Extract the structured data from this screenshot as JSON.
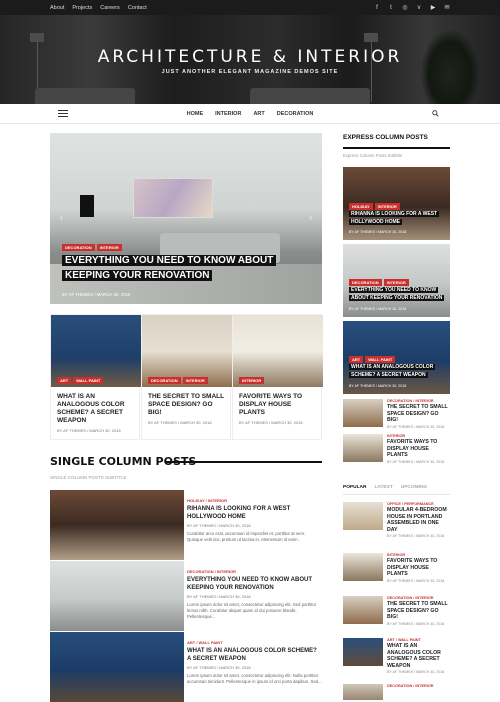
{
  "topbar": {
    "links": [
      "About",
      "Projects",
      "Careers",
      "Contact"
    ],
    "social_icons": [
      "facebook-icon",
      "twitter-icon",
      "instagram-icon",
      "vk-icon",
      "youtube-icon",
      "envelope-icon"
    ]
  },
  "header": {
    "title": "ARCHITECTURE & INTERIOR",
    "tagline": "JUST ANOTHER ELEGANT MAGAZINE DEMOS SITE"
  },
  "nav": {
    "items": [
      "HOME",
      "INTERIOR",
      "ART",
      "DECORATION"
    ],
    "search_icon": "search-icon",
    "menu_icon": "hamburger-icon"
  },
  "featured": {
    "tags": [
      "DECORATION",
      "INTERIOR"
    ],
    "title": "EVERYTHING YOU NEED TO KNOW ABOUT KEEPING YOUR RENOVATION",
    "author": "BY AF THEMES",
    "date": "MARCH 30, 2018"
  },
  "cards": [
    {
      "tags": [
        "ART",
        "WALL PAINT"
      ],
      "title": "WHAT IS AN ANALOGOUS COLOR SCHEME? A SECRET WEAPON",
      "meta": "BY AF THEMES / MARCH 30, 2018"
    },
    {
      "tags": [
        "DECORATION",
        "INTERIOR"
      ],
      "title": "THE SECRET TO SMALL SPACE DESIGN? GO BIG!",
      "meta": "BY AF THEMES / MARCH 30, 2018"
    },
    {
      "tags": [
        "INTERIOR"
      ],
      "title": "FAVORITE WAYS TO DISPLAY HOUSE PLANTS",
      "meta": "BY AF THEMES / MARCH 30, 2018"
    }
  ],
  "single_column": {
    "title": "SINGLE COLUMN POSTS",
    "subtitle": "SINGLE COLUMN POSTS SUBTITLE",
    "posts": [
      {
        "cat": "HOLIDAY / INTERIOR",
        "title": "RIHANNA IS LOOKING FOR A WEST HOLLYWOOD HOME",
        "meta": "BY AF THEMES / MARCH 30, 2018",
        "excerpt": "Curabitur arcu erat, accumsan id imperdiet et, porttitor at sem. Quisque velit nisi, pretium ut lacinia in, elementum id enim."
      },
      {
        "cat": "DECORATION / INTERIOR",
        "title": "EVERYTHING YOU NEED TO KNOW ABOUT KEEPING YOUR RENOVATION",
        "meta": "BY AF THEMES / MARCH 30, 2018",
        "excerpt": "Lorem ipsum dolor sit amet, consectetur adipiscing elit. Sed porttitor lectus nibh. Curabitur aliquet quam id dui posuere blandit. Pellentesque..."
      },
      {
        "cat": "ART / WALL PAINT",
        "title": "WHAT IS AN ANALOGOUS COLOR SCHEME? A SECRET WEAPON",
        "meta": "BY AF THEMES / MARCH 30, 2018",
        "excerpt": "Lorem ipsum dolor sit amet, consectetur adipiscing elit. Nulla porttitor accumsan tincidunt. Pellentesque in ipsum id orci porta dapibus. Sed..."
      }
    ]
  },
  "express": {
    "title": "EXPRESS COLUMN POSTS",
    "subtitle": "Express Column Posts Subtitle",
    "features": [
      {
        "tags": [
          "HOLIDAY",
          "INTERIOR"
        ],
        "title": "RIHANNA IS LOOKING FOR A WEST HOLLYWOOD HOME",
        "meta": "BY AF THEMES / MARCH 30, 2018"
      },
      {
        "tags": [
          "DECORATION",
          "INTERIOR"
        ],
        "title": "EVERYTHING YOU NEED TO KNOW ABOUT KEEPING YOUR RENOVATION",
        "meta": "BY AF THEMES / MARCH 30, 2018"
      },
      {
        "tags": [
          "ART",
          "WALL PAINT"
        ],
        "title": "WHAT IS AN ANALOGOUS COLOR SCHEME? A SECRET WEAPON",
        "meta": "BY AF THEMES / MARCH 30, 2018"
      }
    ],
    "smalls": [
      {
        "cat": "DECORATION / INTERIOR",
        "title": "THE SECRET TO SMALL SPACE DESIGN? GO BIG!",
        "meta": "BY AF THEMES / MARCH 30, 2018"
      },
      {
        "cat": "INTERIOR",
        "title": "FAVORITE WAYS TO DISPLAY HOUSE PLANTS",
        "meta": "BY AF THEMES / MARCH 30, 2018"
      }
    ]
  },
  "tabs": {
    "items": [
      "POPULAR",
      "LATEST",
      "UPCOMING"
    ],
    "active": "POPULAR",
    "posts": [
      {
        "cat": "OFFICE / PERFORMANCE",
        "title": "MODULAR 4-BEDROOM HOUSE IN PORTLAND ASSEMBLED IN ONE DAY",
        "meta": "BY AF THEMES / MARCH 30, 2018"
      },
      {
        "cat": "INTERIOR",
        "title": "FAVORITE WAYS TO DISPLAY HOUSE PLANTS",
        "meta": "BY AF THEMES / MARCH 30, 2018"
      },
      {
        "cat": "DECORATION / INTERIOR",
        "title": "THE SECRET TO SMALL SPACE DESIGN? GO BIG!",
        "meta": "BY AF THEMES / MARCH 30, 2018"
      },
      {
        "cat": "ART / WALL PAINT",
        "title": "WHAT IS AN ANALOGOUS COLOR SCHEME? A SECRET WEAPON",
        "meta": "BY AF THEMES / MARCH 30, 2018"
      },
      {
        "cat": "DECORATION / INTERIOR",
        "title": "",
        "meta": ""
      }
    ]
  },
  "colors": {
    "accent": "#c9302c",
    "dark": "#111111"
  }
}
